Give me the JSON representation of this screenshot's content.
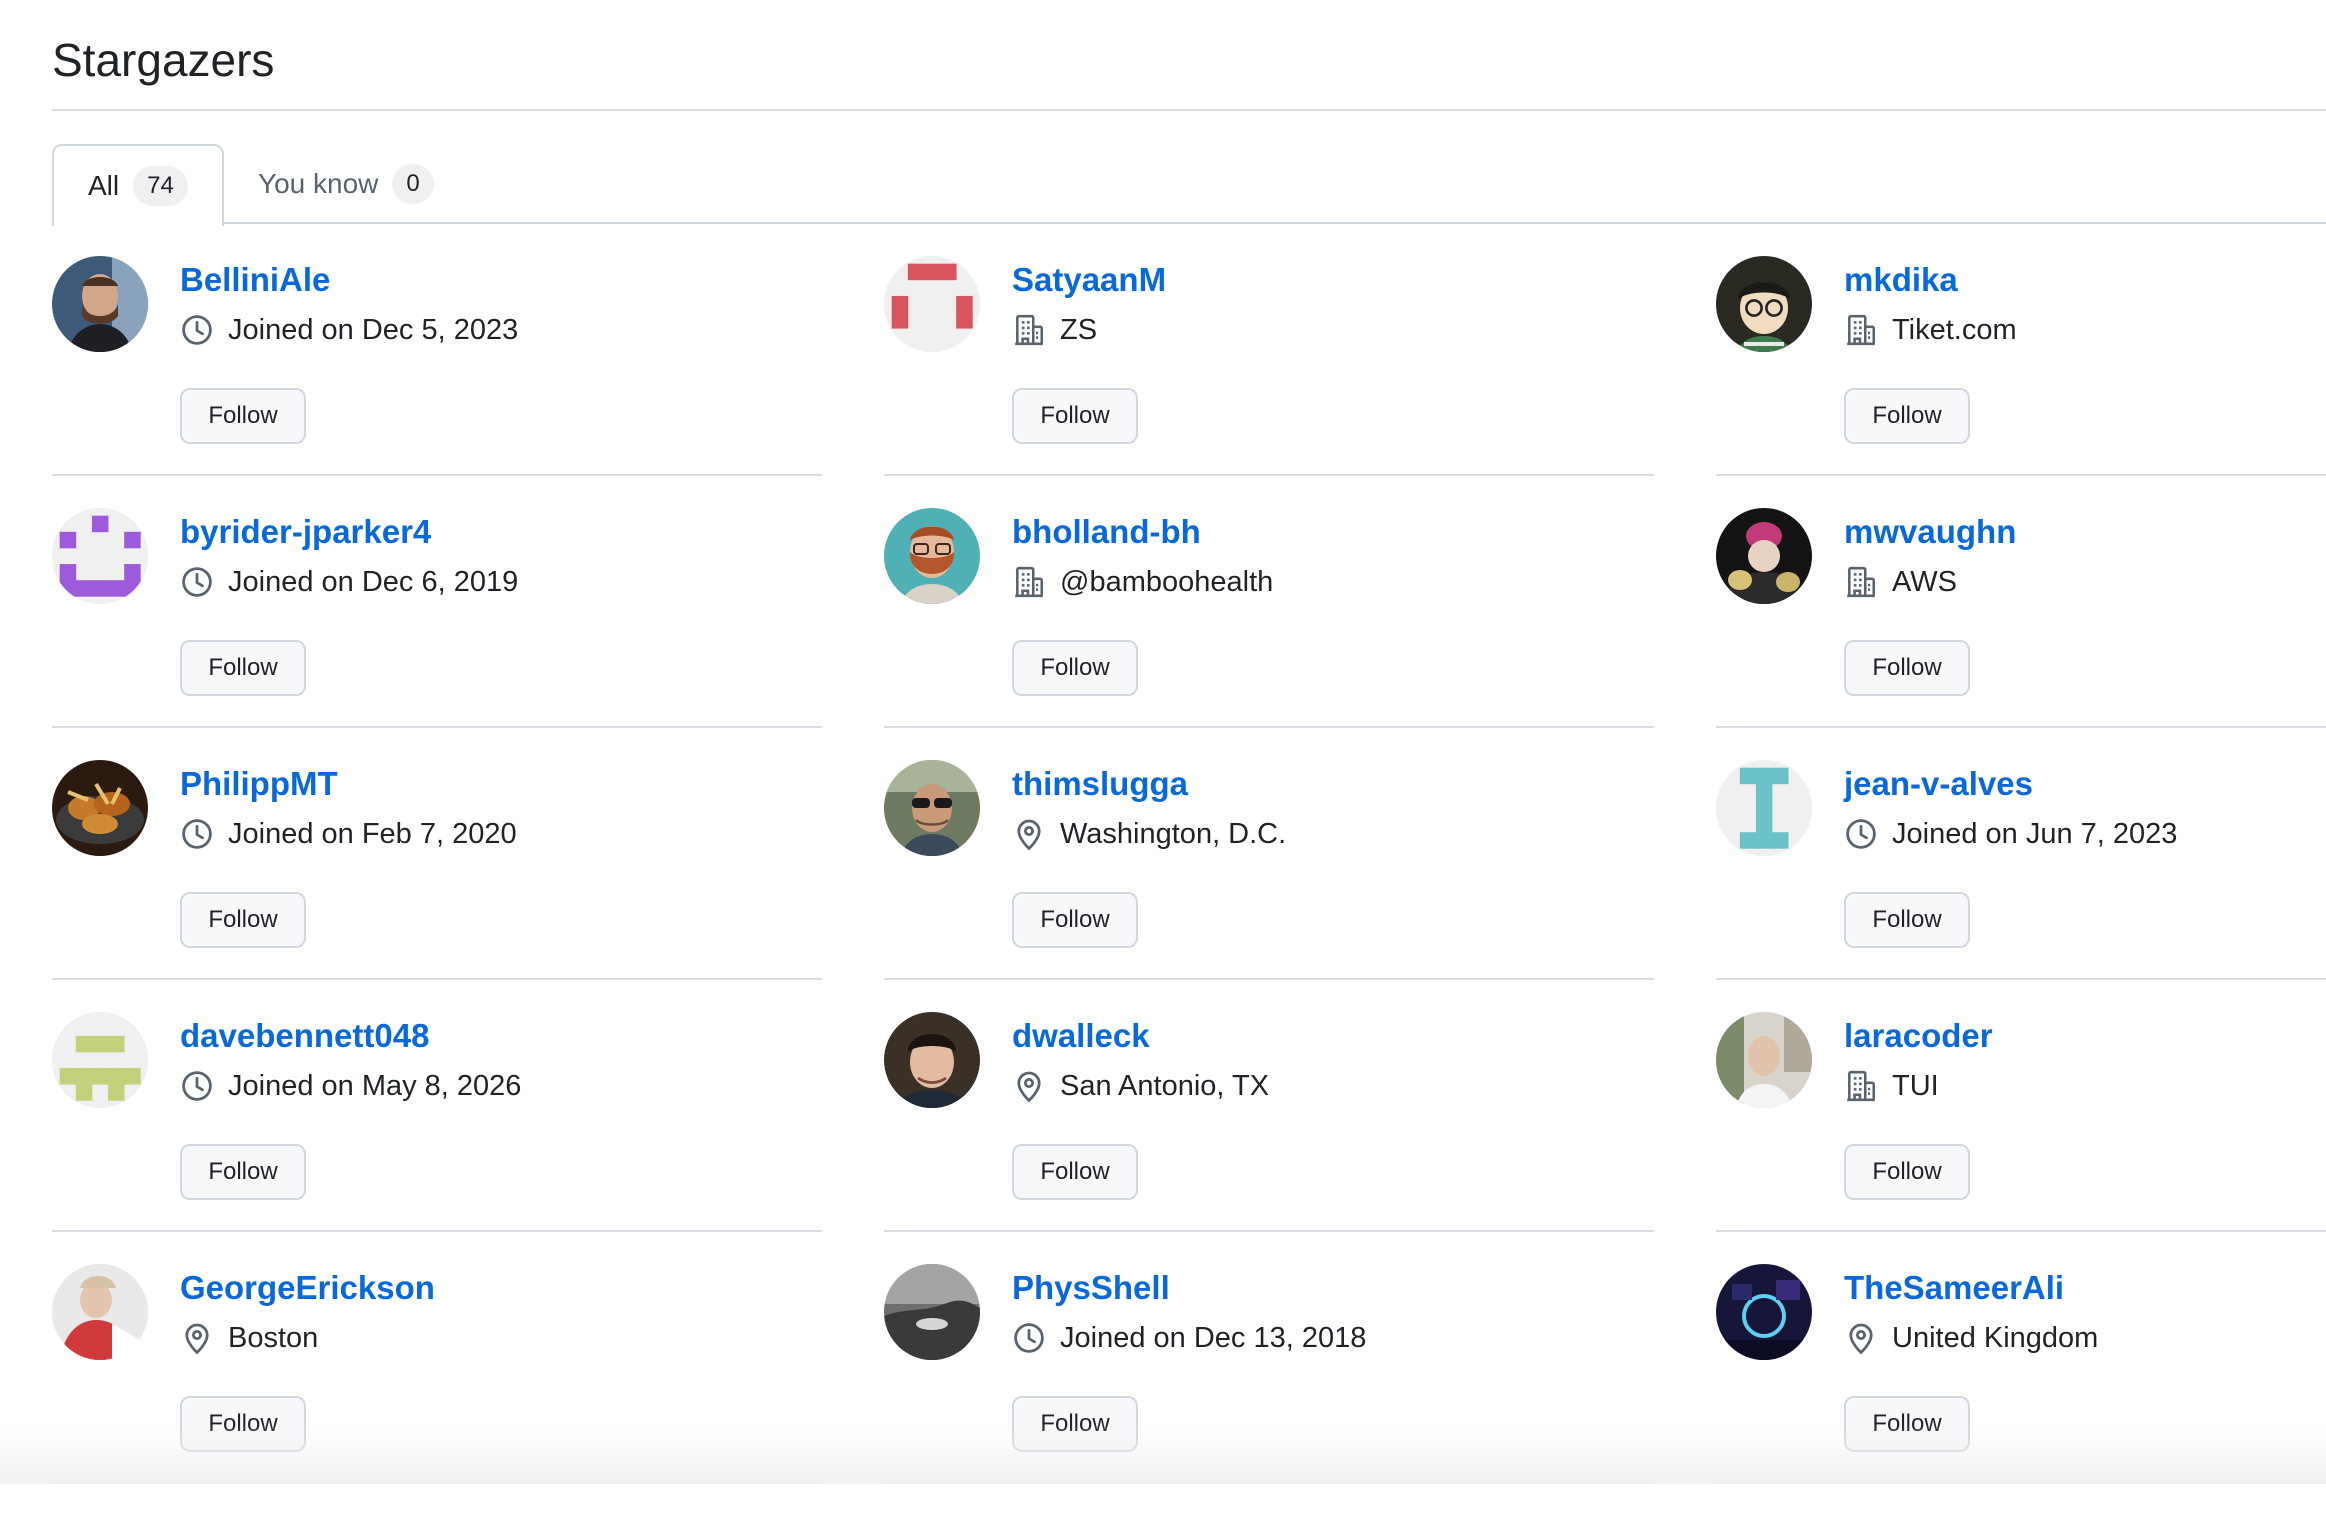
{
  "page": {
    "title": "Stargazers"
  },
  "tabs": [
    {
      "label": "All",
      "count": "74",
      "selected": true
    },
    {
      "label": "You know",
      "count": "0",
      "selected": false
    }
  ],
  "follow_label": "Follow",
  "users": [
    {
      "login": "BelliniAle",
      "meta_type": "joined",
      "meta": "Joined on Dec 5, 2023",
      "avatar": "photo-man-beard"
    },
    {
      "login": "SatyaanM",
      "meta_type": "company",
      "meta": "ZS",
      "avatar": "identicon-red"
    },
    {
      "login": "mkdika",
      "meta_type": "company",
      "meta": "Tiket.com",
      "avatar": "cartoon-glasses"
    },
    {
      "login": "byrider-jparker4",
      "meta_type": "joined",
      "meta": "Joined on Dec 6, 2019",
      "avatar": "identicon-purple"
    },
    {
      "login": "bholland-bh",
      "meta_type": "company",
      "meta": "@bamboohealth",
      "avatar": "illustration-ginger-beard"
    },
    {
      "login": "mwvaughn",
      "meta_type": "company",
      "meta": "AWS",
      "avatar": "photo-dark-costume"
    },
    {
      "login": "PhilippMT",
      "meta_type": "joined",
      "meta": "Joined on Feb 7, 2020",
      "avatar": "photo-food"
    },
    {
      "login": "thimslugga",
      "meta_type": "location",
      "meta": "Washington, D.C.",
      "avatar": "photo-sunglasses"
    },
    {
      "login": "jean-v-alves",
      "meta_type": "joined",
      "meta": "Joined on Jun 7, 2023",
      "avatar": "identicon-teal"
    },
    {
      "login": "davebennett048",
      "meta_type": "joined",
      "meta": "Joined on May 8, 2026",
      "avatar": "identicon-olive"
    },
    {
      "login": "dwalleck",
      "meta_type": "location",
      "meta": "San Antonio, TX",
      "avatar": "photo-dark-hair"
    },
    {
      "login": "laracoder",
      "meta_type": "company",
      "meta": "TUI",
      "avatar": "photo-room"
    },
    {
      "login": "GeorgeErickson",
      "meta_type": "location",
      "meta": "Boston",
      "avatar": "photo-red-shirt"
    },
    {
      "login": "PhysShell",
      "meta_type": "joined",
      "meta": "Joined on Dec 13, 2018",
      "avatar": "photo-grey-landscape"
    },
    {
      "login": "TheSameerAli",
      "meta_type": "location",
      "meta": "United Kingdom",
      "avatar": "photo-neon-room"
    }
  ],
  "colors": {
    "link": "#0969da",
    "identicon_red": "#d9545f",
    "identicon_purple": "#9c5bdb",
    "identicon_teal": "#6cc2c9",
    "identicon_olive": "#c2d17a"
  }
}
